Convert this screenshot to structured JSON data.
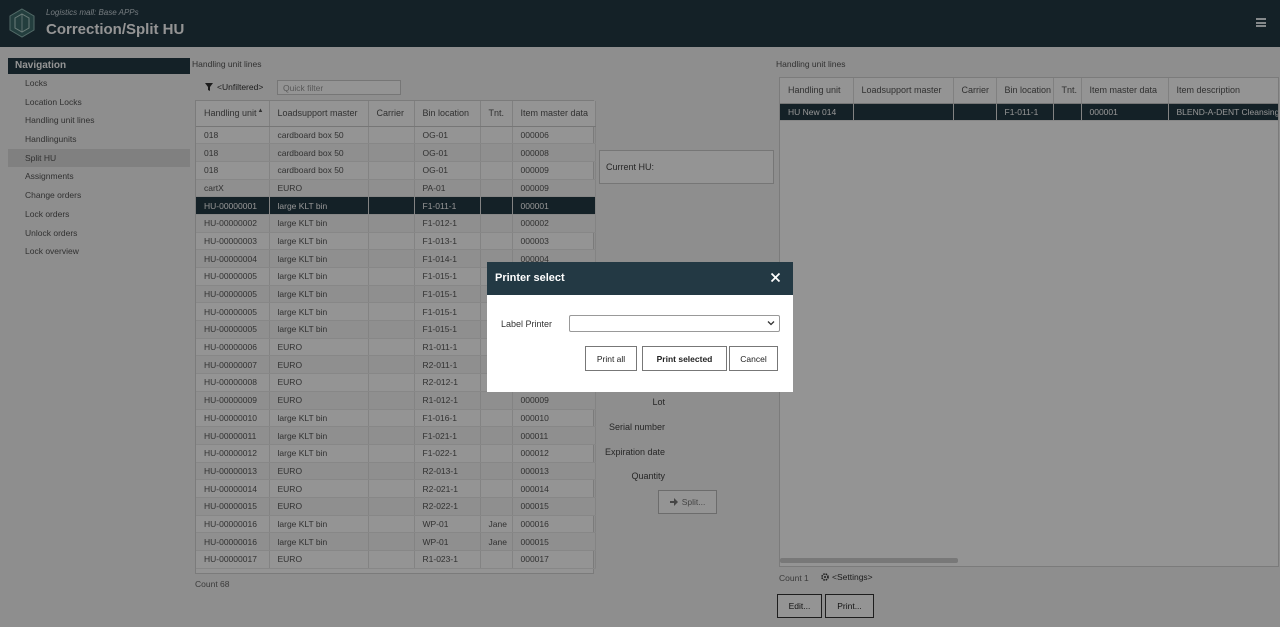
{
  "header": {
    "subtitle": "Logistics mall: Base APPs",
    "title": "Correction/Split HU"
  },
  "navigation": {
    "title": "Navigation",
    "items": [
      "Locks",
      "Location Locks",
      "Handling unit lines",
      "Handlingunits",
      "Split HU",
      "Assignments",
      "Change orders",
      "Lock orders",
      "Unlock orders",
      "Lock overview"
    ],
    "active": "Split HU"
  },
  "left_panel": {
    "section_label": "Handling unit lines",
    "filter_label": "<Unfiltered>",
    "quick_filter_placeholder": "Quick filter",
    "columns": [
      "Handling unit",
      "Loadsupport master",
      "Carrier",
      "Bin location",
      "Tnt.",
      "Item master data"
    ],
    "rows": [
      [
        "018",
        "cardboard box 50",
        "",
        "OG-01",
        "",
        "000006"
      ],
      [
        "018",
        "cardboard box 50",
        "",
        "OG-01",
        "",
        "000008"
      ],
      [
        "018",
        "cardboard box 50",
        "",
        "OG-01",
        "",
        "000009"
      ],
      [
        "cartX",
        "EURO",
        "",
        "PA-01",
        "",
        "000009"
      ],
      [
        "HU-00000001",
        "large KLT bin",
        "",
        "F1-011-1",
        "",
        "000001"
      ],
      [
        "HU-00000002",
        "large KLT bin",
        "",
        "F1-012-1",
        "",
        "000002"
      ],
      [
        "HU-00000003",
        "large KLT bin",
        "",
        "F1-013-1",
        "",
        "000003"
      ],
      [
        "HU-00000004",
        "large KLT bin",
        "",
        "F1-014-1",
        "",
        "000004"
      ],
      [
        "HU-00000005",
        "large KLT bin",
        "",
        "F1-015-1",
        "",
        ""
      ],
      [
        "HU-00000005",
        "large KLT bin",
        "",
        "F1-015-1",
        "",
        ""
      ],
      [
        "HU-00000005",
        "large KLT bin",
        "",
        "F1-015-1",
        "",
        ""
      ],
      [
        "HU-00000005",
        "large KLT bin",
        "",
        "F1-015-1",
        "",
        ""
      ],
      [
        "HU-00000006",
        "EURO",
        "",
        "R1-011-1",
        "",
        ""
      ],
      [
        "HU-00000007",
        "EURO",
        "",
        "R2-011-1",
        "",
        ""
      ],
      [
        "HU-00000008",
        "EURO",
        "",
        "R2-012-1",
        "",
        ""
      ],
      [
        "HU-00000009",
        "EURO",
        "",
        "R1-012-1",
        "",
        "000009"
      ],
      [
        "HU-00000010",
        "large KLT bin",
        "",
        "F1-016-1",
        "",
        "000010"
      ],
      [
        "HU-00000011",
        "large KLT bin",
        "",
        "F1-021-1",
        "",
        "000011"
      ],
      [
        "HU-00000012",
        "large KLT bin",
        "",
        "F1-022-1",
        "",
        "000012"
      ],
      [
        "HU-00000013",
        "EURO",
        "",
        "R2-013-1",
        "",
        "000013"
      ],
      [
        "HU-00000014",
        "EURO",
        "",
        "R2-021-1",
        "",
        "000014"
      ],
      [
        "HU-00000015",
        "EURO",
        "",
        "R2-022-1",
        "",
        "000015"
      ],
      [
        "HU-00000016",
        "large KLT bin",
        "",
        "WP-01",
        "Jane",
        "000016"
      ],
      [
        "HU-00000016",
        "large KLT bin",
        "",
        "WP-01",
        "Jane",
        "000015"
      ],
      [
        "HU-00000017",
        "EURO",
        "",
        "R1-023-1",
        "",
        "000017"
      ]
    ],
    "selected_row": 4,
    "count": "Count 68"
  },
  "middle_panel": {
    "current_hu_label": "Current HU:",
    "labels": [
      "Lot",
      "Serial number",
      "Expiration date",
      "Quantity"
    ],
    "split_label": "Split..."
  },
  "right_panel": {
    "section_label": "Handling unit lines",
    "columns": [
      "Handling unit",
      "Loadsupport master",
      "Carrier",
      "Bin location",
      "Tnt.",
      "Item master data",
      "Item description"
    ],
    "rows": [
      [
        "HU New 014",
        "",
        "",
        "F1-011-1",
        "",
        "000001",
        "BLEND-A-DENT Cleansing"
      ]
    ],
    "count": "Count 1",
    "settings_label": "<Settings>",
    "edit_label": "Edit...",
    "print_label": "Print..."
  },
  "dialog": {
    "title": "Printer select",
    "printer_label": "Label Printer",
    "printer_value": "",
    "print_all": "Print all",
    "print_selected": "Print selected",
    "cancel": "Cancel"
  },
  "colors": {
    "header": "#233944",
    "selected_row": "#233944"
  }
}
